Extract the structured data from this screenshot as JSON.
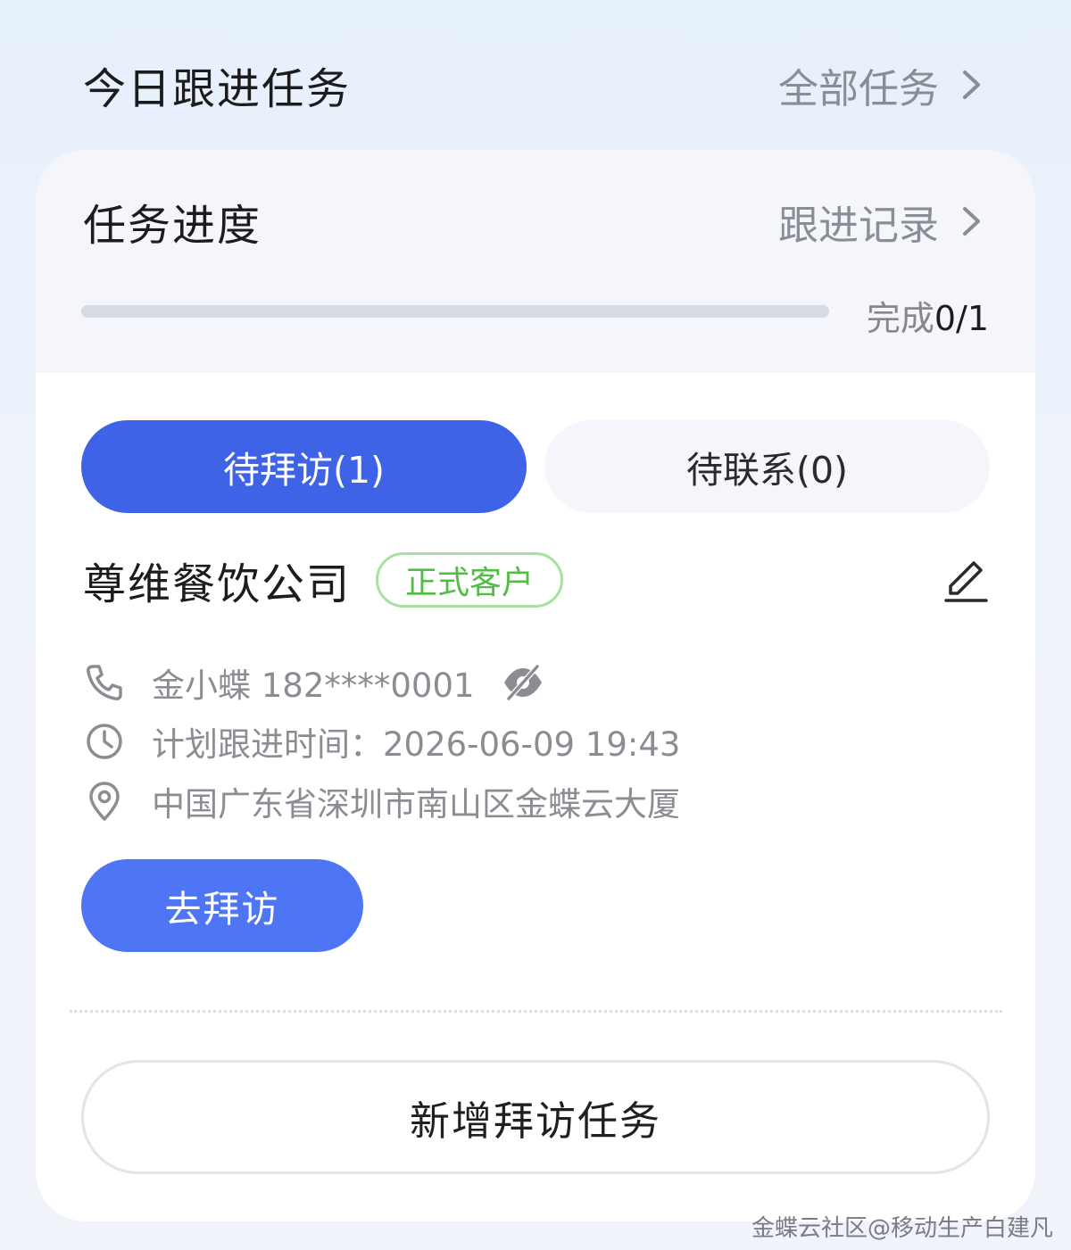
{
  "header": {
    "title": "今日跟进任务",
    "all_tasks_label": "全部任务"
  },
  "progress": {
    "title": "任务进度",
    "records_label": "跟进记录",
    "done_prefix": "完成",
    "done_count": "0/1",
    "fraction": 0
  },
  "tabs": [
    {
      "label": "待拜访(1)",
      "active": true
    },
    {
      "label": "待联系(0)",
      "active": false
    }
  ],
  "customer": {
    "name": "尊维餐饮公司",
    "badge": "正式客户",
    "contact": "金小蝶 182****0001",
    "plan_time": "计划跟进时间：2026-06-09 19:43",
    "address": "中国广东省深圳市南山区金蝶云大厦",
    "visit_label": "去拜访"
  },
  "add_task_label": "新增拜访任务",
  "watermark": "金蝶云社区@移动生产白建凡",
  "colors": {
    "primary": "#3e63e6",
    "badge_green": "#4fbe43",
    "muted": "#8b8d93"
  },
  "icons": [
    "chevron-right-icon",
    "edit-icon",
    "phone-icon",
    "eye-off-icon",
    "clock-icon",
    "location-icon"
  ]
}
